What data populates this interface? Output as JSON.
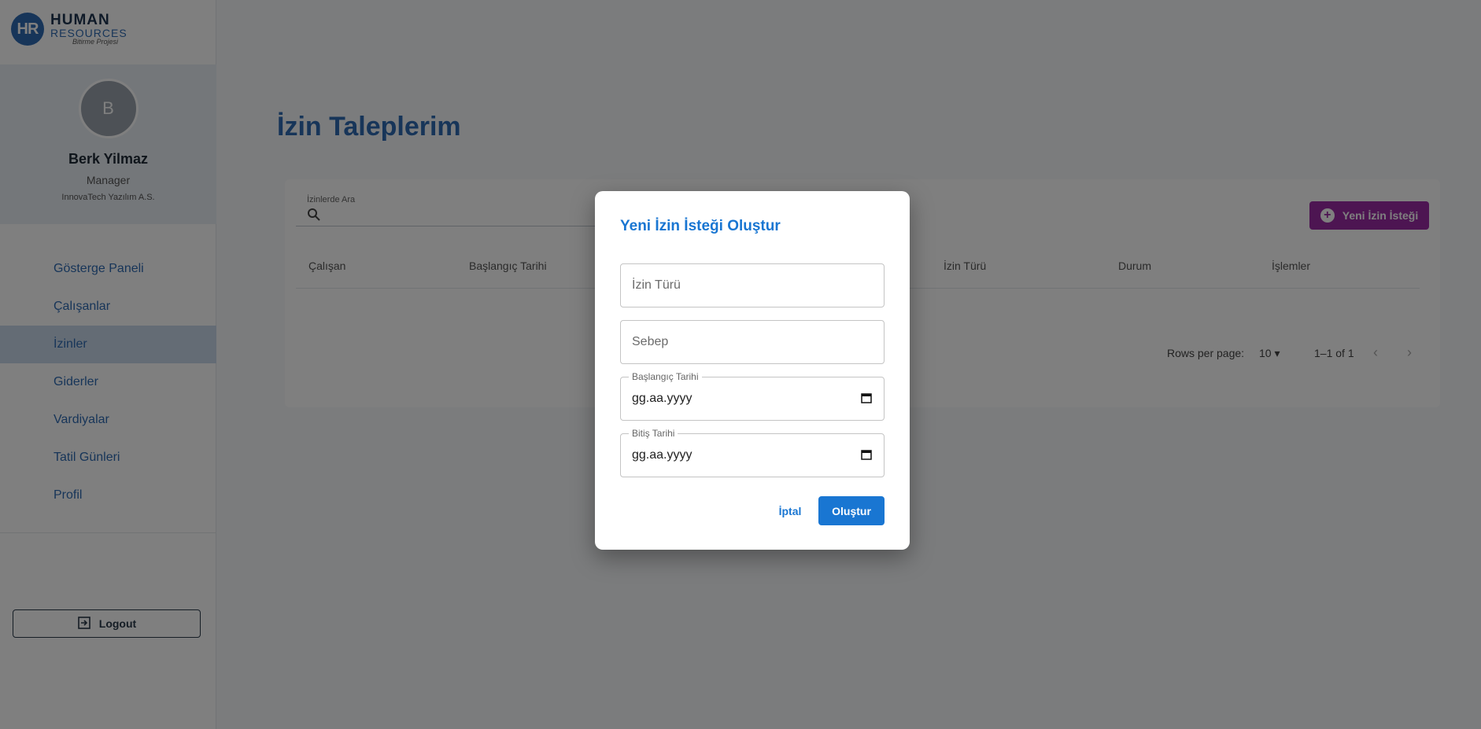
{
  "logo": {
    "initials": "HR",
    "title": "HUMAN",
    "subtitle": "RESOURCES",
    "tagline": "Bitirme Projesi"
  },
  "profile": {
    "initial": "B",
    "name": "Berk Yilmaz",
    "role": "Manager",
    "company": "InnovaTech Yazılım A.S."
  },
  "nav": [
    {
      "label": "Gösterge Paneli",
      "active": false
    },
    {
      "label": "Çalışanlar",
      "active": false
    },
    {
      "label": "İzinler",
      "active": true
    },
    {
      "label": "Giderler",
      "active": false
    },
    {
      "label": "Vardiyalar",
      "active": false
    },
    {
      "label": "Tatil Günleri",
      "active": false
    },
    {
      "label": "Profil",
      "active": false
    }
  ],
  "logout_label": "Logout",
  "page": {
    "title": "İzin Taleplerim",
    "search_label": "İzinlerde Ara",
    "new_button": "Yeni İzin İsteği",
    "columns": [
      "Çalışan",
      "Başlangıç Tarihi",
      "İzin Türü",
      "Durum",
      "İşlemler"
    ],
    "rows_per_page_label": "Rows per page:",
    "rows_per_page_value": "10",
    "pagination_text": "1–1 of 1"
  },
  "modal": {
    "title": "Yeni İzin İsteği Oluştur",
    "leave_type_placeholder": "İzin Türü",
    "reason_placeholder": "Sebep",
    "start_label": "Başlangıç Tarihi",
    "start_value": "gg.aa.yyyy",
    "end_label": "Bitiş Tarihi",
    "end_value": "gg.aa.yyyy",
    "cancel_label": "İptal",
    "create_label": "Oluştur"
  },
  "colors": {
    "primary": "#1976d2",
    "brand": "#2f6bb2",
    "accent_purple": "#9b2aa5"
  }
}
